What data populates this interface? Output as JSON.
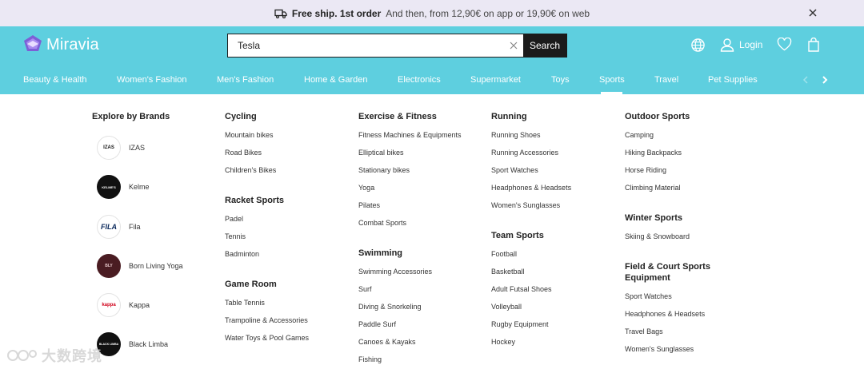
{
  "promo": {
    "bold": "Free ship. 1st order",
    "rest": "And then, from 12,90€ on app or 19,90€ on web"
  },
  "logo": {
    "text": "Miravia"
  },
  "search": {
    "value": "Tesla",
    "button": "Search"
  },
  "header": {
    "login": "Login"
  },
  "nav": {
    "items": [
      "Beauty & Health",
      "Women's Fashion",
      "Men's Fashion",
      "Home & Garden",
      "Electronics",
      "Supermarket",
      "Toys",
      "Sports",
      "Travel",
      "Pet Supplies"
    ],
    "active": "Sports"
  },
  "brands": {
    "title": "Explore by Brands",
    "items": [
      {
        "name": "IZAS",
        "logo": "IZAS"
      },
      {
        "name": "Kelme",
        "logo": "KELME'S"
      },
      {
        "name": "Fila",
        "logo": "FILA"
      },
      {
        "name": "Born Living Yoga",
        "logo": "BLY"
      },
      {
        "name": "Kappa",
        "logo": "kappa"
      },
      {
        "name": "Black Limba",
        "logo": "BLACK LIMBA"
      }
    ]
  },
  "columns": {
    "c2": {
      "cycling": {
        "title": "Cycling",
        "items": [
          "Mountain bikes",
          "Road Bikes",
          "Children's Bikes"
        ]
      },
      "racket": {
        "title": "Racket Sports",
        "items": [
          "Padel",
          "Tennis",
          "Badminton"
        ]
      },
      "game": {
        "title": "Game Room",
        "items": [
          "Table Tennis",
          "Trampoline & Accessories",
          "Water Toys & Pool Games"
        ]
      }
    },
    "c3": {
      "fitness": {
        "title": "Exercise & Fitness",
        "items": [
          "Fitness Machines & Equipments",
          "Elliptical bikes",
          "Stationary bikes",
          "Yoga",
          "Pilates",
          "Combat Sports"
        ]
      },
      "swimming": {
        "title": "Swimming",
        "items": [
          "Swimming Accessories",
          "Surf",
          "Diving & Snorkeling",
          "Paddle Surf",
          "Canoes & Kayaks",
          "Fishing"
        ]
      }
    },
    "c4": {
      "running": {
        "title": "Running",
        "items": [
          "Running Shoes",
          "Running Accessories",
          "Sport Watches",
          "Headphones & Headsets",
          "Women's Sunglasses"
        ]
      },
      "team": {
        "title": "Team Sports",
        "items": [
          "Football",
          "Basketball",
          "Adult Futsal Shoes",
          "Volleyball",
          "Rugby Equipment",
          "Hockey"
        ]
      }
    },
    "c5": {
      "outdoor": {
        "title": "Outdoor Sports",
        "items": [
          "Camping",
          "Hiking Backpacks",
          "Horse Riding",
          "Climbing Material"
        ]
      },
      "winter": {
        "title": "Winter Sports",
        "items": [
          "Skiing & Snowboard"
        ]
      },
      "field": {
        "title": "Field & Court Sports Equipment",
        "items": [
          "Sport Watches",
          "Headphones & Headsets",
          "Travel Bags",
          "Women's Sunglasses"
        ]
      }
    }
  },
  "watermark": {
    "text": "大数跨境"
  },
  "colors": {
    "header": "#5ecfdf",
    "promo_bg": "#ebe8f4",
    "search_button": "#1b1b1b"
  }
}
